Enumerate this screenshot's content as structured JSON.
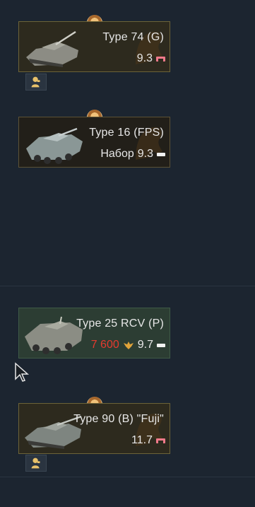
{
  "vehicles": [
    {
      "name": "Type 74 (G)",
      "prefix": "",
      "price": "",
      "br": "9.3",
      "flag": "pink",
      "style": "premium"
    },
    {
      "name": "Type 16 (FPS)",
      "prefix": "Набор",
      "price": "",
      "br": "9.3",
      "flag": "white",
      "style": "premium-dark"
    },
    {
      "name": "Type 25 RCV (P)",
      "prefix": "",
      "price": "7 600",
      "br": "9.7",
      "flag": "white",
      "style": "researched"
    },
    {
      "name": "Type 90 (B) \"Fuji\"",
      "prefix": "",
      "price": "",
      "br": "11.7",
      "flag": "pink",
      "style": "premium"
    }
  ],
  "colors": {
    "background": "#1c2530",
    "price_red": "#e63a2e",
    "premium_card": "#2d2a1e",
    "researched_card": "#2c3d33"
  },
  "icons": {
    "medal": "premium-medal-icon",
    "crew": "crew-icon",
    "eagle": "golden-eagle-icon",
    "cursor": "mouse-cursor-icon"
  }
}
